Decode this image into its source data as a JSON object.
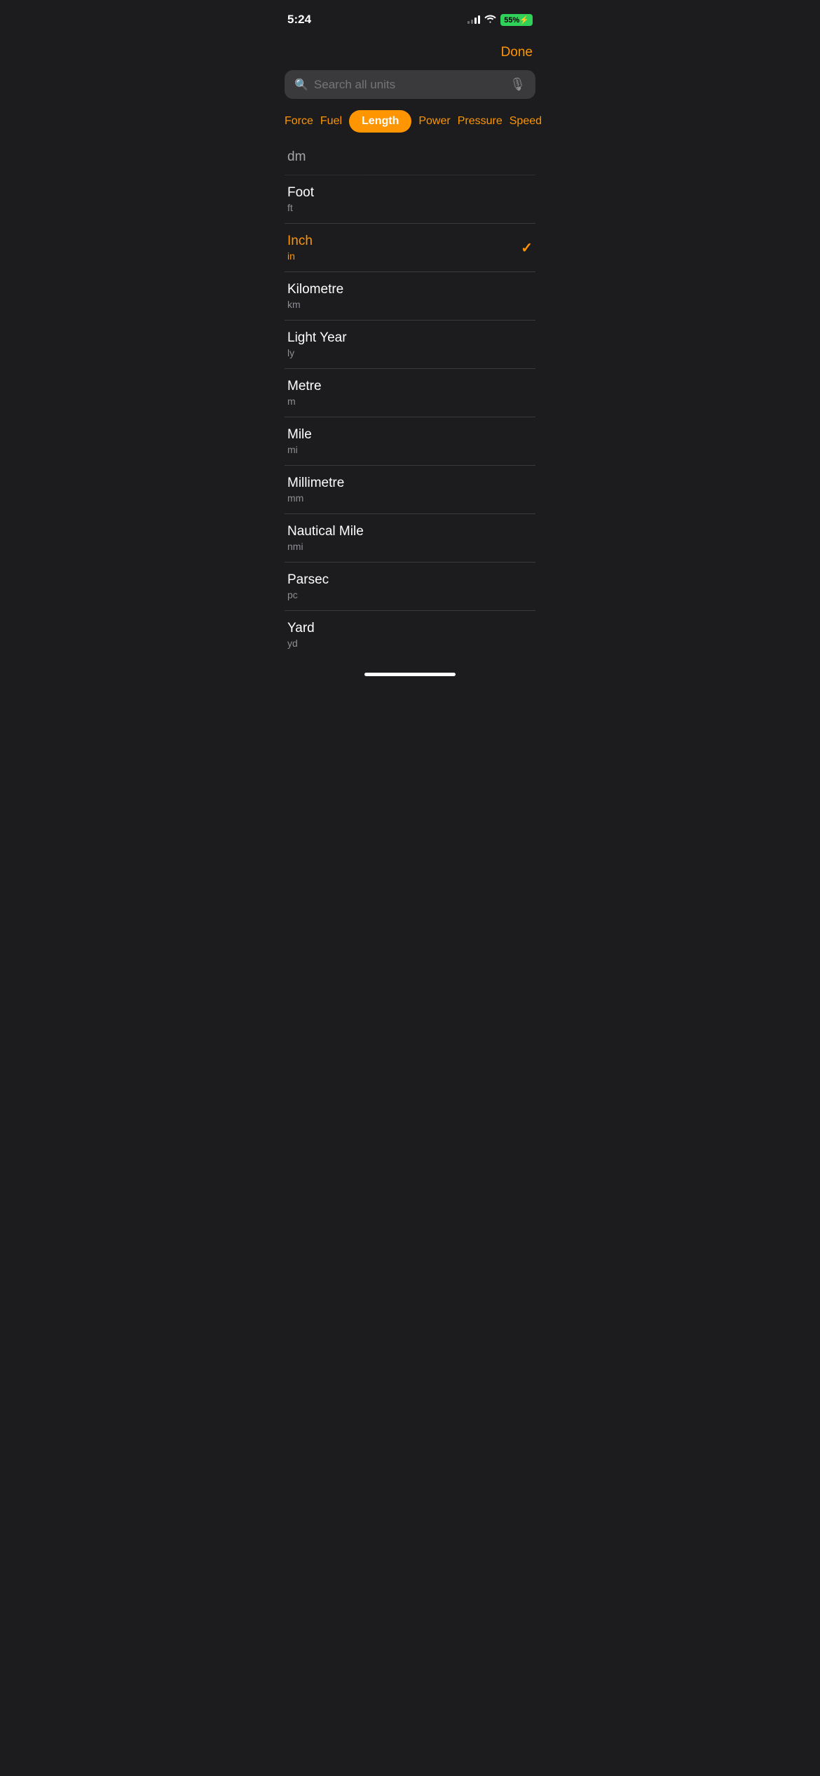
{
  "statusBar": {
    "time": "5:24",
    "battery": "55"
  },
  "header": {
    "doneLabel": "Done"
  },
  "search": {
    "placeholder": "Search all units"
  },
  "categories": [
    {
      "id": "force",
      "label": "Force",
      "active": false
    },
    {
      "id": "fuel",
      "label": "Fuel",
      "active": false
    },
    {
      "id": "length",
      "label": "Length",
      "active": true
    },
    {
      "id": "power",
      "label": "Power",
      "active": false
    },
    {
      "id": "pressure",
      "label": "Pressure",
      "active": false
    },
    {
      "id": "speed",
      "label": "Speed",
      "active": false
    }
  ],
  "units": [
    {
      "name": "dm",
      "abbr": "",
      "selected": false,
      "partial": true
    },
    {
      "name": "Foot",
      "abbr": "ft",
      "selected": false,
      "partial": false
    },
    {
      "name": "Inch",
      "abbr": "in",
      "selected": true,
      "partial": false
    },
    {
      "name": "Kilometre",
      "abbr": "km",
      "selected": false,
      "partial": false
    },
    {
      "name": "Light Year",
      "abbr": "ly",
      "selected": false,
      "partial": false
    },
    {
      "name": "Metre",
      "abbr": "m",
      "selected": false,
      "partial": false
    },
    {
      "name": "Mile",
      "abbr": "mi",
      "selected": false,
      "partial": false
    },
    {
      "name": "Millimetre",
      "abbr": "mm",
      "selected": false,
      "partial": false
    },
    {
      "name": "Nautical Mile",
      "abbr": "nmi",
      "selected": false,
      "partial": false
    },
    {
      "name": "Parsec",
      "abbr": "pc",
      "selected": false,
      "partial": false
    },
    {
      "name": "Yard",
      "abbr": "yd",
      "selected": false,
      "partial": false
    }
  ]
}
